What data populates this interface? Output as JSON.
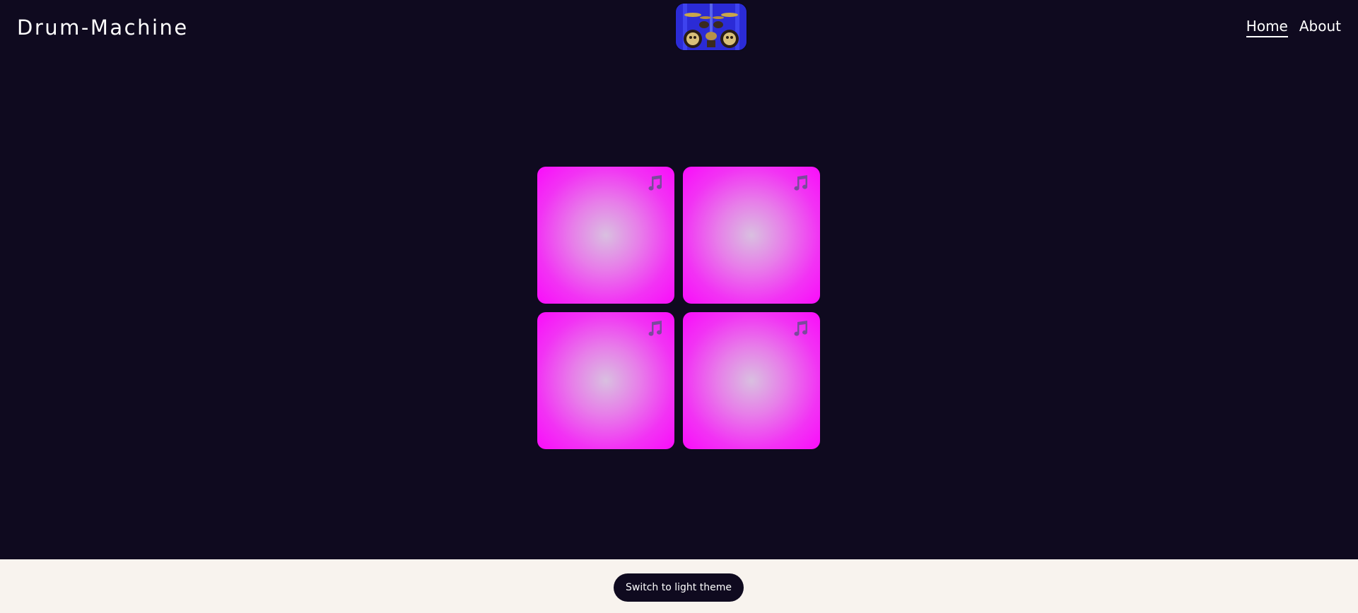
{
  "header": {
    "brand": "Drum-Machine",
    "logo_icon": "drum-kit-image",
    "nav": [
      {
        "label": "Home",
        "active": true
      },
      {
        "label": "About",
        "active": false
      }
    ]
  },
  "pads": [
    {
      "icon": "music-notes-icon"
    },
    {
      "icon": "music-notes-icon"
    },
    {
      "icon": "music-notes-icon"
    },
    {
      "icon": "music-notes-icon"
    }
  ],
  "footer": {
    "theme_button_label": "Switch to light theme"
  },
  "colors": {
    "background": "#0f0a1f",
    "pad": "#fa0cfb",
    "pad_center": "#d9bfe0",
    "footer": "#f8f3ee",
    "icon": "#7b4a9c"
  }
}
